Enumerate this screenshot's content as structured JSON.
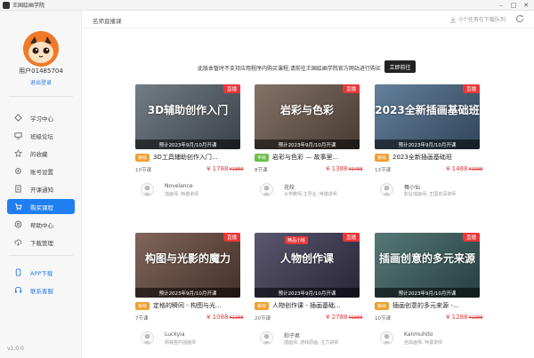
{
  "window": {
    "title": "王国绘画学院",
    "minimize": "–",
    "maximize": "□",
    "close": "✕"
  },
  "user": {
    "name": "用户01485704",
    "logout": "退出登录"
  },
  "nav": [
    {
      "label": "学习中心",
      "icon": "monitor-icon"
    },
    {
      "label": "班级论坛",
      "icon": "screen-icon"
    },
    {
      "label": "的收藏",
      "icon": "star-icon"
    },
    {
      "label": "账号设置",
      "icon": "gear-icon"
    },
    {
      "label": "开课通知",
      "icon": "document-icon"
    },
    {
      "label": "购买课程",
      "icon": "cart-icon",
      "active": true
    },
    {
      "label": "帮助中心",
      "icon": "help-icon"
    },
    {
      "label": "下载管理",
      "icon": "cloud-download-icon"
    }
  ],
  "nav_bottom": [
    {
      "label": "APP下载",
      "icon": "phone-icon"
    },
    {
      "label": "联系客服",
      "icon": "headset-icon"
    }
  ],
  "version": "v1.0.0",
  "header": {
    "title": "名师直播课",
    "downloads": "0个任务在下载队列"
  },
  "notice": {
    "text": "此版本暂时不支持应用程序内购买课程,请前往王国绘画学院官方网站进行购买",
    "button": "立即前往"
  },
  "colors": {
    "accent": "#1f7ff0",
    "price": "#e9373a",
    "live": "#e9373a"
  },
  "courses": [
    {
      "thumb_text": "3D辅助创作入门",
      "live": "直播",
      "date": "预计2023年9月/10月开课",
      "badge": "板绘",
      "badge_color": "#f0a030",
      "title": "3D工具辅助创作入门...",
      "lessons": "10节课",
      "price": "¥ 1788",
      "old": "¥1888",
      "teacher": "Novelance",
      "role": "插画师, 特邀讲师",
      "bg": "#5a6670"
    },
    {
      "thumb_text": "岩彩与色彩",
      "live": "直播",
      "date": "预计2023年9月/10月开课",
      "badge": "手绘",
      "badge_color": "#6cbe4a",
      "title": "岩彩与色彩 — 故事里...",
      "lessons": "8节课",
      "price": "¥ 1388",
      "old": "¥1488",
      "teacher": "花皎",
      "role": "大学教师,主导业, 特邀讲师",
      "bg": "#6e5a4c"
    },
    {
      "thumb_text": "2023全新插画基础班",
      "live": "直播",
      "date": "预计2023年9月/10月开课",
      "badge": "板绘",
      "badge_color": "#f0a030",
      "title": "2023全新插画基础班",
      "lessons": "13节课",
      "price": "¥ 1488",
      "old": "¥1588",
      "teacher": "舞小仙",
      "role": "职业插画师, 王国资深讲师",
      "bg": "#4a6a8a"
    },
    {
      "thumb_text": "构图与光影的魔力",
      "live": "直播",
      "date": "预计2023年9月/10月开课",
      "badge": "板绘",
      "badge_color": "#f0a030",
      "title": "定格的瞬间 - 构图与光...",
      "lessons": "7节课",
      "price": "¥ 1088",
      "old": "¥1188",
      "teacher": "Luckyia",
      "role": "网易签约插画师",
      "bg": "#6a4a3e"
    },
    {
      "thumb_text": "人物创作课",
      "live": "直播",
      "tagtop": "精品小班",
      "date": "预计2023年9月/10月开课",
      "badge": "板绘",
      "badge_color": "#f0a030",
      "title": "人物创作课 - 插画基础...",
      "lessons": "20节课",
      "price": "¥ 2788",
      "old": "¥2888",
      "teacher": "和子君",
      "role": "插画师, 游戏原画, 主力讲师",
      "bg": "#3e3a56"
    },
    {
      "thumb_text": "插画创意的多元来源",
      "live": "直播",
      "date": "预计2023年9月/10月开课",
      "badge": "板绘",
      "badge_color": "#f0a030",
      "title": "插画创意的多元来源 -...",
      "lessons": "10节课",
      "price": "¥ 1288",
      "old": "¥1388",
      "teacher": "Kanmuhito",
      "role": "自由画师, 特邀讲师",
      "bg": "#3a6060"
    }
  ]
}
